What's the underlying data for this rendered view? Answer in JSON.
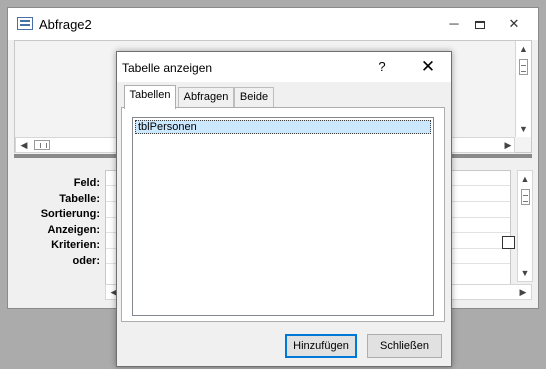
{
  "query_window": {
    "title": "Abfrage2",
    "controls": {
      "minimize": "─",
      "close": "✕"
    },
    "row_labels": [
      "Feld:",
      "Tabelle:",
      "Sortierung:",
      "Anzeigen:",
      "Kriterien:",
      "oder:"
    ],
    "scroll": {
      "up": "▲",
      "down": "▼",
      "left": "◀",
      "right": "▶"
    }
  },
  "dialog": {
    "title": "Tabelle anzeigen",
    "help": "?",
    "close": "✕",
    "tabs": [
      {
        "label": "Tabellen",
        "active": true
      },
      {
        "label": "Abfragen",
        "active": false
      },
      {
        "label": "Beide",
        "active": false
      }
    ],
    "list_items": [
      {
        "label": "tblPersonen",
        "selected": true
      }
    ],
    "buttons": {
      "add": "Hinzufügen",
      "close": "Schließen"
    }
  },
  "colors": {
    "selection": "#cce8ff",
    "default_button_border": "#0078d7",
    "background": "#ababab"
  }
}
